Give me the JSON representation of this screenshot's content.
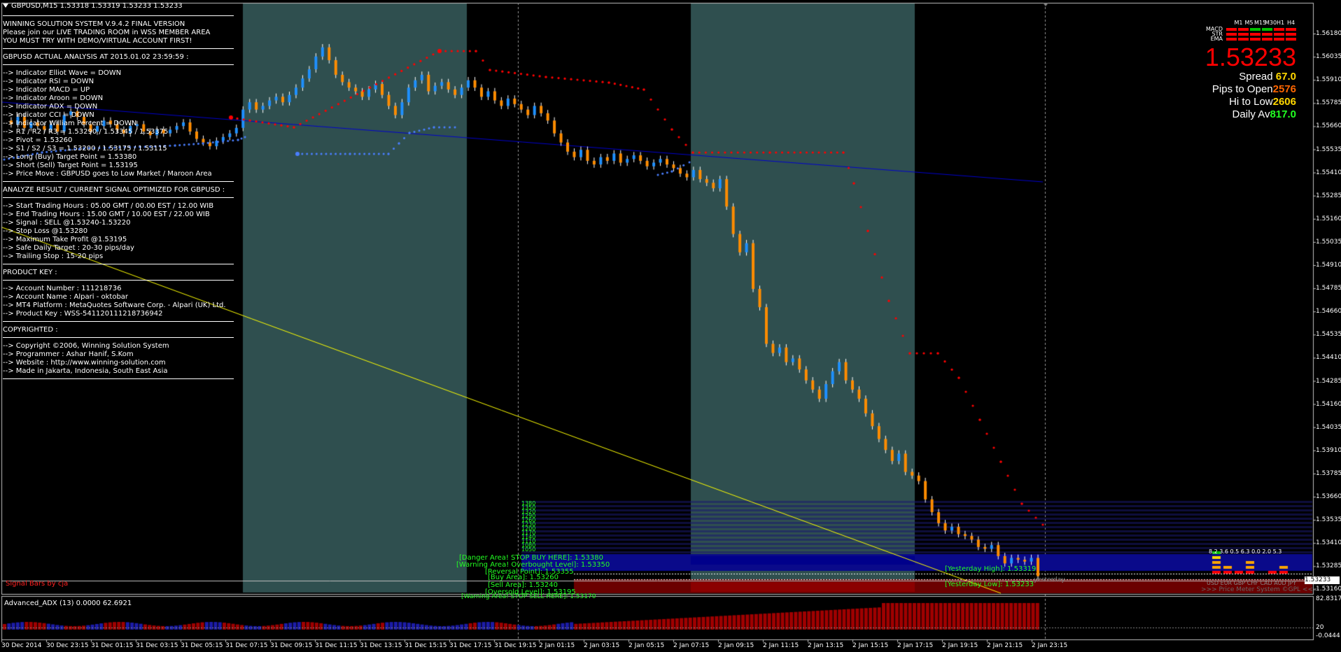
{
  "chart_title": "GBPUSD,M15  1.53318 1.53319 1.53233 1.53233",
  "info_panel": {
    "header": [
      "WINNING SOLUTION SYSTEM V.9.4.2 FINAL VERSION",
      "Please join our LIVE TRADING ROOM in WSS MEMBER AREA",
      "YOU MUST TRY WITH DEMO/VIRTUAL ACCOUNT FIRST!"
    ],
    "analysis_title": "GBPUSD ACTUAL ANALYSIS AT 2015.01.02 23:59:59 :",
    "analysis": [
      "--> Indicator Elliot Wave = DOWN",
      "--> Indicator RSI = DOWN",
      "--> Indicator MACD = UP",
      "--> Indicator Aroon = DOWN",
      "--> Indicator ADX = DOWN",
      "--> Indicator CCI = DOWN",
      "--> Indicator William Percent = DOWN",
      "--> R1 / R2 / R3 = 1.53290 / 1.53345 / 1.53375",
      "--> Pivot = 1.53260",
      "--> S1 / S2 / S3 = 1.53200 / 1.53175 / 1.53115",
      "--> Long (Buy) Target Point = 1.53380",
      "--> Short (Sell) Target Point = 1.53195",
      "--> Price Move : GBPUSD goes to Low Market / Maroon Area"
    ],
    "result_title": "ANALYZE RESULT / CURRENT SIGNAL OPTIMIZED FOR GBPUSD :",
    "result": [
      "--> Start Trading Hours : 05.00 GMT / 00.00 EST / 12.00 WIB",
      "--> End Trading Hours : 15.00 GMT / 10.00 EST / 22.00 WIB",
      "--> Signal : SELL @1.53240-1.53220",
      "--> Stop Loss @1.53280",
      "--> Maximum Take Profit @1.53195",
      "--> Safe Daily Target : 20-30 pips/day",
      "--> Trailing Stop : 15-20 pips"
    ],
    "product_title": "PRODUCT KEY :",
    "product": [
      "--> Account Number : 111218736",
      "--> Account Name : Alpari - oktobar",
      "--> MT4 Platform : MetaQuotes Software Corp. - Alpari (UK) Ltd.",
      "--> Product Key : WSS-541120111218736942"
    ],
    "copyright_title": "COPYRIGHTED :",
    "copyright": [
      "--> Copyright ©2006, Winning Solution System",
      "--> Programmer : Ashar Hanif, S.Kom",
      "--> Website : http://www.winning-solution.com",
      "--> Made in Jakarta, Indonesia, South East Asia"
    ]
  },
  "meter": {
    "timeframes": [
      "M1",
      "M5",
      "M15",
      "M30",
      "H1",
      "H4"
    ],
    "rows": [
      {
        "label": "MACD",
        "colors": [
          "#ff0000",
          "#ff0000",
          "#00c000",
          "#00c000",
          "#ff0000",
          "#ff0000"
        ]
      },
      {
        "label": "STR",
        "colors": [
          "#ff0000",
          "#ff0000",
          "#ff0000",
          "#ff0000",
          "#ff0000",
          "#ff0000"
        ]
      },
      {
        "label": "EMA",
        "colors": [
          "#ff0000",
          "#ff0000",
          "#ff0000",
          "#ff0000",
          "#ff0000",
          "#ff0000"
        ]
      }
    ],
    "price": "1.53233",
    "spread_label": "Spread",
    "spread_value": "67.0",
    "pips_open_label": "Pips to Open",
    "pips_open_value": "2576",
    "hi_low_label": "Hi to Low",
    "hi_low_value": "2606",
    "daily_label": "Daily Av",
    "daily_value": "817.0",
    "colors": {
      "spread": "#ffd700",
      "pips_open": "#ff6600",
      "hi_low": "#ffd700",
      "daily": "#22ff22"
    }
  },
  "price_axis": [
    "1.56180",
    "1.56035",
    "1.55910",
    "1.55785",
    "1.55660",
    "1.55535",
    "1.55410",
    "1.55285",
    "1.55160",
    "1.55035",
    "1.54910",
    "1.54785",
    "1.54660",
    "1.54535",
    "1.54410",
    "1.54285",
    "1.54160",
    "1.54035",
    "1.53910",
    "1.53785",
    "1.53660",
    "1.53535",
    "1.53410",
    "1.53285",
    "1.53160"
  ],
  "current_price_tag": "1.53233",
  "time_axis": [
    "30 Dec 2014",
    "30 Dec 23:15",
    "31 Dec 01:15",
    "31 Dec 03:15",
    "31 Dec 05:15",
    "31 Dec 07:15",
    "31 Dec 09:15",
    "31 Dec 11:15",
    "31 Dec 13:15",
    "31 Dec 15:15",
    "31 Dec 17:15",
    "31 Dec 19:15",
    "2 Jan 01:15",
    "2 Jan 03:15",
    "2 Jan 05:15",
    "2 Jan 07:15",
    "2 Jan 09:15",
    "2 Jan 11:15",
    "2 Jan 13:15",
    "2 Jan 15:15",
    "2 Jan 17:15",
    "2 Jan 19:15",
    "2 Jan 21:15",
    "2 Jan 23:15"
  ],
  "levels": {
    "danger": "[Danger Area! STOP BUY HERE]: 1.53380",
    "warning": "[Warning Area! Overbought Level]: 1.53350",
    "reversal": "[Reversal Point]: 1.53355",
    "buy": "[Buy Area]: 1.53260",
    "sell": "[Sell Area]: 1.53240",
    "oversold": "[Oversold Level]: 1.53195",
    "warning_bottom": "[Warning Area! STOP SELL HERE]: 1.53170",
    "yesterday_high": "[Yesterday High]: 1.53319",
    "yesterday_low": "[Yesterday Low]: 1.53233",
    "yesterday": "yesterday"
  },
  "signal_bars_label": "Signal Bars by cja",
  "adx_title": "Advanced_ADX (13) 0.0000 62.6921",
  "adx_axis": [
    "82.8317",
    "20",
    "-0.0444"
  ],
  "price_meter": {
    "currencies": "USD EUR GBP CHF CAD AUD JPY",
    "values": "8.2 3.6 0.5 6.3 0.0 2.0 5.3",
    "credit": ">>> Price Meter System ©GPL <<<"
  },
  "pivot_ladder": [
    "1380",
    "1350",
    "1320",
    "1290",
    "1260",
    "1230",
    "1200",
    "1170",
    "1140",
    "1110",
    "1080",
    "1050"
  ],
  "colors": {
    "bull_candle": "#1e90ff",
    "bear_candle": "#ff8c00",
    "supertrend_red": "#ff0000",
    "supertrend_blue": "#4a7fff",
    "trendline": "#0000cd",
    "yellow_line": "#ffff00",
    "session_shade": "#2f4f4f"
  }
}
